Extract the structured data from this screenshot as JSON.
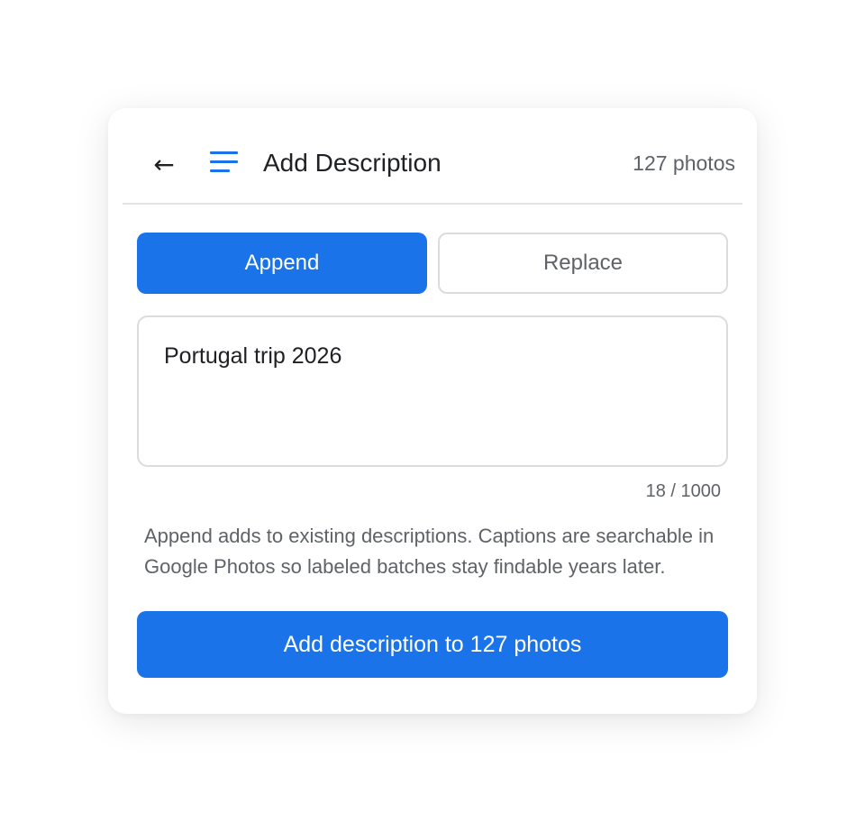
{
  "header": {
    "back_icon": "arrow-left-icon",
    "back_glyph": "←",
    "description_icon": "notes-lines-icon",
    "title": "Add Description",
    "photo_count": "127 photos"
  },
  "mode": {
    "options": [
      "Append",
      "Replace"
    ],
    "selected": "Append"
  },
  "description_input": {
    "value": "Portugal trip 2026",
    "char_count": "18 / 1000"
  },
  "help_text": "Append adds to existing descriptions. Captions are searchable in Google Photos so labeled batches stay findable years later.",
  "submit_label": "Add description to 127 photos",
  "colors": {
    "accent": "#1a73e8",
    "text_primary": "#202124",
    "text_secondary": "#5f6368",
    "border": "#dadce0"
  }
}
